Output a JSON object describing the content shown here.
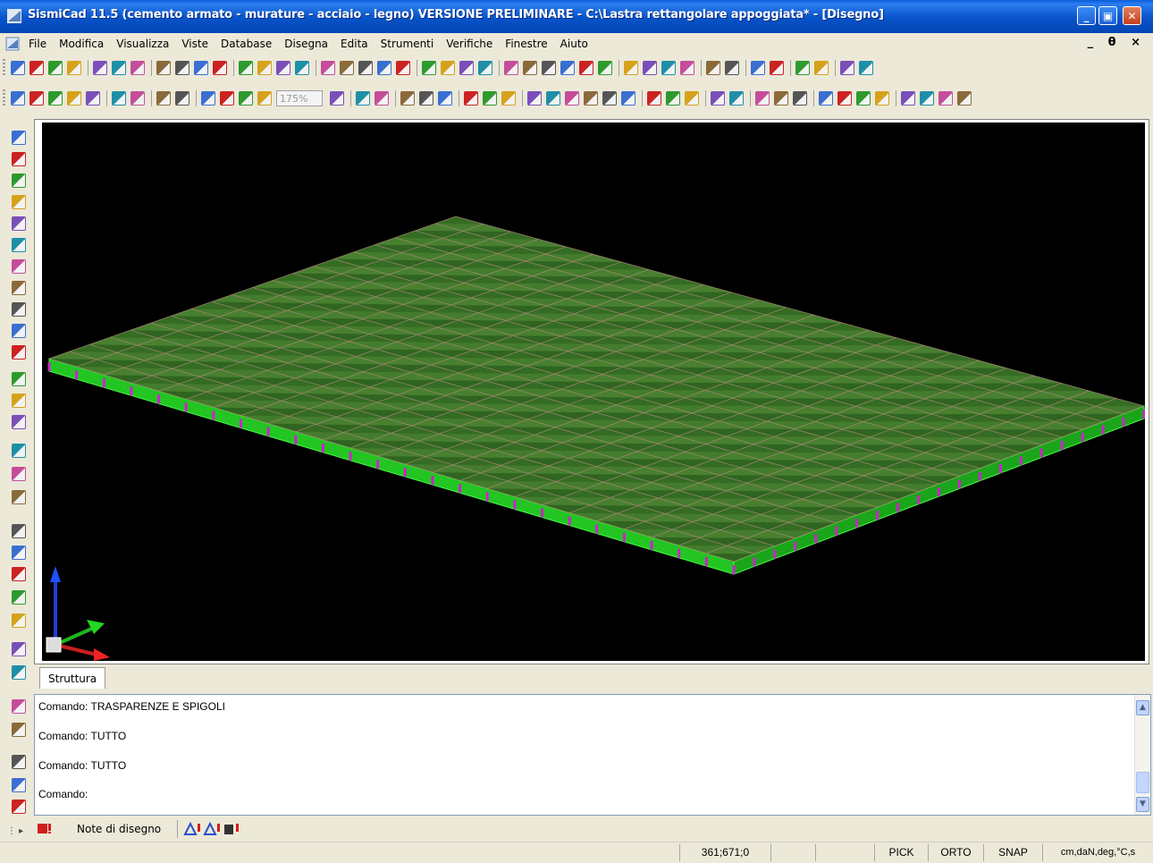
{
  "window": {
    "title": "SismiCad 11.5 (cemento armato - murature - acciaio - legno) VERSIONE PRELIMINARE - C:\\Lastra rettangolare appoggiata* - [Disegno]",
    "buttons": [
      "minimize",
      "restore",
      "close"
    ]
  },
  "menu": {
    "items": [
      "File",
      "Modifica",
      "Visualizza",
      "Viste",
      "Database",
      "Disegna",
      "Edita",
      "Strumenti",
      "Verifiche",
      "Finestre",
      "Aiuto"
    ],
    "mdi_controls": "_ θ ×"
  },
  "toolbar2": {
    "zoom_value": "175%"
  },
  "tabs": {
    "active": "Struttura"
  },
  "command_window": {
    "lines": [
      "Comando: TRASPARENZE E SPIGOLI",
      "Comando: TUTTO",
      "Comando: TUTTO",
      "Comando:"
    ]
  },
  "bottom_bar": {
    "notes_label": "Note di disegno"
  },
  "status_bar": {
    "coordinates": "361;671;0",
    "pick": "PICK",
    "orto": "ORTO",
    "snap": "SNAP",
    "units": "cm,daN,deg,°C,s"
  },
  "colors": {
    "titlebar": "#0753c9",
    "viewport_bg": "#000000",
    "slab_fill": "#3a7a1e",
    "slab_edge": "#22dd22",
    "supports": "#cc22cc"
  }
}
